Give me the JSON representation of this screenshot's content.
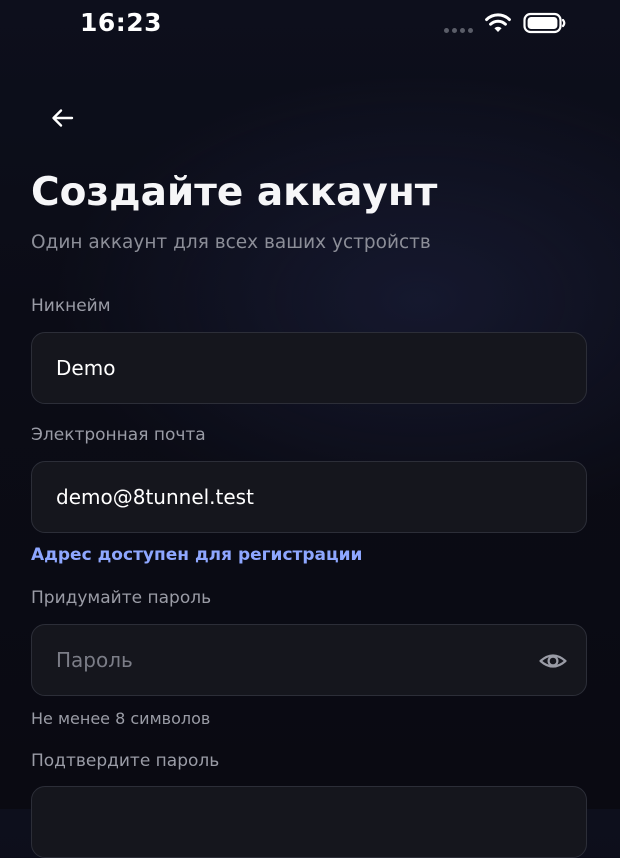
{
  "status_bar": {
    "time": "16:23",
    "icons": [
      "cellular-icon",
      "wifi-icon",
      "battery-icon"
    ]
  },
  "header": {
    "back_icon": "arrow-left-icon",
    "title": "Создайте аккаунт",
    "subtitle": "Один аккаунт для всех ваших устройств"
  },
  "form": {
    "nickname": {
      "label": "Никнейм",
      "value": "Demo"
    },
    "email": {
      "label": "Электронная почта",
      "value": "demo@8tunnel.test",
      "status": "Адрес доступен для регистрации"
    },
    "password": {
      "label": "Придумайте пароль",
      "value": "",
      "placeholder": "Пароль",
      "hint": "Не менее 8 символов",
      "toggle_icon": "eye-icon"
    },
    "confirm_password": {
      "label": "Подтвердите пароль",
      "value": ""
    }
  },
  "colors": {
    "background": "#0b0c16",
    "field_background": "#15161d",
    "field_border": "#2c2e38",
    "success_hint": "#8ea7ff",
    "muted_text": "#9a9ca6"
  }
}
